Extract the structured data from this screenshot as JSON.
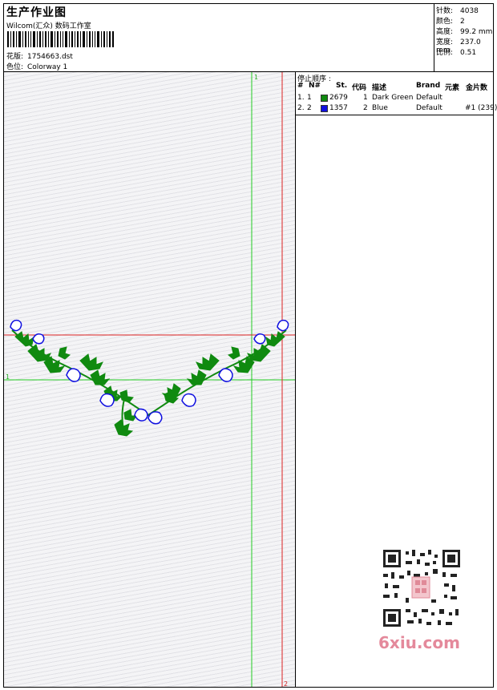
{
  "header": {
    "title": "生产作业图",
    "subtitle": "Wilcom(汇众) 数码工作室",
    "design_label": "花版:",
    "design_value": "1754663.dst",
    "colorway_label": "色位:",
    "colorway_value": "Colorway 1"
  },
  "stats": {
    "stitches_label": "针数:",
    "stitches": "4038",
    "colors_label": "颜色:",
    "colors": "2",
    "height_label": "高度:",
    "height": "99.2 mm",
    "width_label": "宽度:",
    "width": "237.0 mm",
    "scale_label": "比例:",
    "scale": "0.51"
  },
  "stop_sequence": {
    "title": "停止顺序 :",
    "columns": [
      "#",
      "N#",
      "St.",
      "代码",
      "描述",
      "Brand",
      "元素",
      "金片数"
    ],
    "rows": [
      {
        "idx": "1.",
        "n": "1",
        "color": "#108a10",
        "st": "2679",
        "code": "1",
        "desc": "Dark Green",
        "brand": "Default",
        "element": "",
        "sequins": ""
      },
      {
        "idx": "2.",
        "n": "2",
        "color": "#1010e0",
        "st": "1357",
        "code": "2",
        "desc": "Blue",
        "brand": "Default",
        "element": "",
        "sequins": "#1 (239)"
      }
    ]
  },
  "guides": {
    "green_v": "1",
    "green_h": "1",
    "red_v": "2"
  },
  "watermark": {
    "logo": "6xiu.com"
  }
}
